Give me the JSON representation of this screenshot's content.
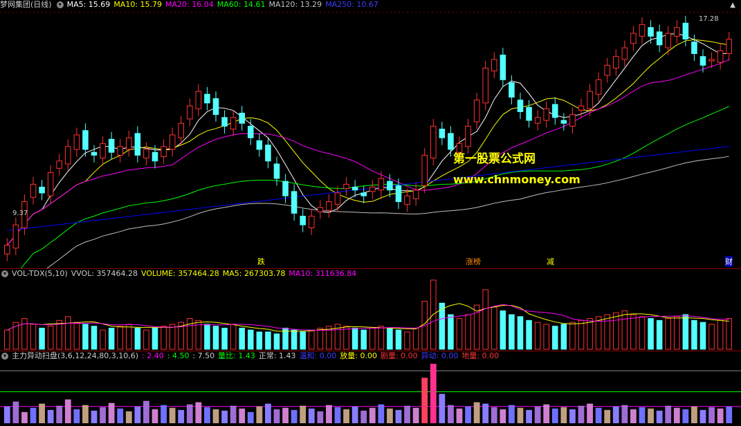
{
  "main_header": {
    "title": "梦网集团(日线)",
    "ma5": "MA5: 15.69",
    "ma10": "MA10: 15.79",
    "ma20": "MA20: 16.04",
    "ma60": "MA60: 14.61",
    "ma120": "MA120: 13.29",
    "ma250": "MA250: 10.67"
  },
  "price_labels": {
    "high": "17.28",
    "low": "9.37"
  },
  "watermark": {
    "line1": "第一股票公式网",
    "line2": "www.chnmoney.com"
  },
  "events": [
    "跌",
    "涨榜",
    "减",
    "财"
  ],
  "vol_header": {
    "name": "VOL-TDX(5,10)",
    "vvol": "VVOL: 357464.28",
    "volume": "VOLUME: 357464.28",
    "ma5": "MA5: 267303.78",
    "ma10": "MA10: 311636.84"
  },
  "scan_header": {
    "name": "主力异动扫盘(3,6,12,24,80,3,10,6)",
    "v1": ": 2.40",
    "v2": ": 4.50",
    "v3": ": 7.50",
    "liangbi": "量比: 1.43",
    "zhengchang": "正常: 1.43",
    "wenhe": "温和: 0.00",
    "fangliang": "放量: 0.00",
    "juliang": "剧量: 0.00",
    "yidong": "异动: 0.00",
    "diliang": "地量: 0.00"
  },
  "colors": {
    "up": "#ff3232",
    "down": "#54ffff",
    "ma5": "#ffffff",
    "ma10": "#ffff00",
    "ma20": "#ff00ff",
    "ma60": "#00ff00",
    "ma120": "#c0c0c0",
    "ma250": "#0000ff"
  },
  "chart_data": {
    "type": "candlestick",
    "price_range": [
      9.37,
      17.28
    ],
    "closes": [
      9.5,
      10.2,
      11.0,
      11.6,
      11.3,
      12.0,
      12.4,
      12.9,
      13.3,
      12.8,
      12.6,
      13.0,
      12.7,
      12.9,
      13.2,
      12.6,
      12.8,
      12.4,
      12.9,
      13.3,
      13.7,
      14.3,
      14.8,
      14.4,
      14.0,
      13.6,
      13.9,
      13.7,
      13.2,
      12.8,
      12.4,
      11.8,
      11.2,
      10.6,
      10.2,
      10.5,
      10.8,
      11.0,
      11.3,
      11.6,
      11.4,
      11.2,
      11.5,
      11.8,
      11.4,
      11.0,
      11.2,
      11.4,
      12.6,
      13.6,
      13.2,
      12.8,
      13.0,
      13.6,
      14.5,
      15.6,
      15.9,
      15.2,
      14.6,
      14.1,
      13.8,
      13.9,
      14.2,
      13.9,
      13.7,
      14.0,
      14.3,
      14.8,
      15.2,
      15.7,
      16.0,
      16.3,
      16.8,
      17.1,
      16.7,
      16.4,
      16.8,
      17.0,
      16.6,
      16.1,
      15.7,
      15.9,
      16.2,
      16.6
    ],
    "volumes": [
      20,
      28,
      32,
      26,
      22,
      24,
      30,
      34,
      28,
      26,
      24,
      20,
      22,
      24,
      26,
      22,
      20,
      22,
      24,
      26,
      28,
      32,
      30,
      26,
      24,
      22,
      26,
      22,
      20,
      18,
      18,
      16,
      22,
      20,
      18,
      20,
      22,
      24,
      26,
      24,
      22,
      20,
      22,
      24,
      22,
      20,
      18,
      22,
      50,
      72,
      48,
      36,
      32,
      36,
      46,
      62,
      44,
      40,
      36,
      34,
      30,
      28,
      26,
      24,
      26,
      28,
      30,
      32,
      34,
      36,
      38,
      40,
      36,
      34,
      32,
      30,
      32,
      34,
      36,
      30,
      28,
      26,
      30,
      32
    ],
    "scan_values": [
      2.4,
      3.1,
      1.6,
      2.2,
      2.8,
      1.9,
      2.5,
      3.4,
      2.0,
      2.6,
      1.8,
      2.3,
      2.9,
      2.1,
      1.7,
      2.4,
      3.2,
      2.0,
      2.6,
      2.2,
      1.9,
      2.7,
      3.0,
      2.3,
      2.0,
      1.8,
      2.5,
      2.1,
      1.6,
      2.4,
      2.8,
      2.0,
      2.2,
      1.9,
      2.5,
      2.1,
      1.7,
      2.6,
      2.3,
      2.0,
      2.4,
      1.8,
      2.2,
      2.7,
      2.1,
      1.9,
      2.5,
      2.2,
      6.5,
      8.5,
      4.2,
      2.6,
      2.1,
      2.4,
      3.0,
      2.8,
      2.3,
      2.0,
      2.6,
      2.2,
      1.9,
      2.4,
      2.7,
      2.1,
      2.3,
      2.0,
      2.5,
      2.8,
      2.2,
      1.9,
      2.4,
      2.6,
      2.0,
      2.3,
      2.1,
      1.8,
      2.5,
      2.2,
      2.0,
      2.4,
      1.9,
      2.3,
      2.1,
      2.4
    ]
  }
}
